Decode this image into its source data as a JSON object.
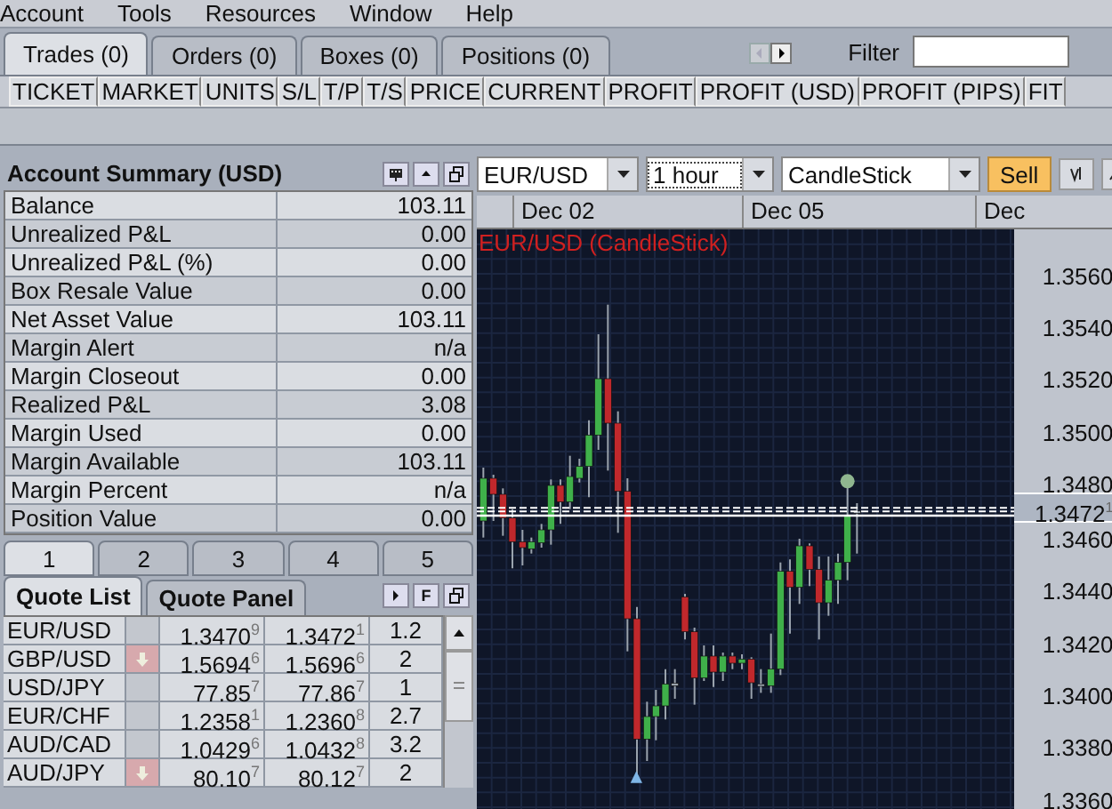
{
  "menu": [
    "Account",
    "Tools",
    "Resources",
    "Window",
    "Help"
  ],
  "trades_panel": {
    "tabs": [
      {
        "label": "Trades (0)",
        "selected": true
      },
      {
        "label": "Orders (0)",
        "selected": false
      },
      {
        "label": "Boxes (0)",
        "selected": false
      },
      {
        "label": "Positions (0)",
        "selected": false
      }
    ],
    "filter_label": "Filter",
    "columns": [
      "TICKET",
      "MARKET",
      "UNITS",
      "S/L",
      "T/P",
      "T/S",
      "PRICE",
      "CURRENT",
      "PROFIT",
      "PROFIT (USD)",
      "PROFIT (PIPS)",
      "FIT"
    ]
  },
  "account_summary": {
    "title": "Account Summary (USD)",
    "rows": [
      {
        "label": "Balance",
        "value": "103.11"
      },
      {
        "label": "Unrealized P&L",
        "value": "0.00"
      },
      {
        "label": "Unrealized P&L (%)",
        "value": "0.00"
      },
      {
        "label": "Box Resale Value",
        "value": "0.00"
      },
      {
        "label": "Net Asset Value",
        "value": "103.11"
      },
      {
        "label": "Margin Alert",
        "value": "n/a"
      },
      {
        "label": "Margin Closeout",
        "value": "0.00"
      },
      {
        "label": "Realized P&L",
        "value": "3.08"
      },
      {
        "label": "Margin Used",
        "value": "0.00"
      },
      {
        "label": "Margin Available",
        "value": "103.11"
      },
      {
        "label": "Margin Percent",
        "value": "n/a"
      },
      {
        "label": "Position Value",
        "value": "0.00"
      }
    ]
  },
  "page_tabs": [
    {
      "label": "1",
      "selected": true
    },
    {
      "label": "2",
      "selected": false
    },
    {
      "label": "3",
      "selected": false
    },
    {
      "label": "4",
      "selected": false
    },
    {
      "label": "5",
      "selected": false
    }
  ],
  "quotes": {
    "tabs": [
      {
        "label": "Quote List",
        "selected": true
      },
      {
        "label": "Quote Panel",
        "selected": false
      }
    ],
    "f_button": "F",
    "rows": [
      {
        "pair": "EUR/USD",
        "down": false,
        "bid": "1.3470$^{9}$",
        "ask": "1.3472$^{1}$",
        "spread": "1.2"
      },
      {
        "pair": "GBP/USD",
        "down": true,
        "bid": "1.5694$^{6}$",
        "ask": "1.5696$^{6}$",
        "spread": "2"
      },
      {
        "pair": "USD/JPY",
        "down": false,
        "bid": "77.85$^{7}$",
        "ask": "77.86$^{7}$",
        "spread": "1"
      },
      {
        "pair": "EUR/CHF",
        "down": false,
        "bid": "1.2358$^{1}$",
        "ask": "1.2360$^{8}$",
        "spread": "2.7"
      },
      {
        "pair": "AUD/CAD",
        "down": false,
        "bid": "1.0429$^{6}$",
        "ask": "1.0432$^{8}$",
        "spread": "3.2"
      },
      {
        "pair": "AUD/JPY",
        "down": true,
        "bid": "80.10$^{7}$",
        "ask": "80.12$^{7}$",
        "spread": "2"
      }
    ]
  },
  "chart": {
    "symbol": "EUR/USD",
    "interval": "1 hour",
    "style": "CandleStick",
    "sell": "Sell",
    "dates": [
      "Dec 02",
      "Dec 05",
      "Dec"
    ],
    "title": "EUR/USD (CandleStick)",
    "price_labels": [
      "1.3560",
      "1.3540",
      "1.3520",
      "1.3500",
      "1.3480",
      "1.3460",
      "1.3440",
      "1.3420",
      "1.3400",
      "1.3380",
      "1.3360"
    ],
    "current_price": "1.3472$^{1}$"
  }
}
